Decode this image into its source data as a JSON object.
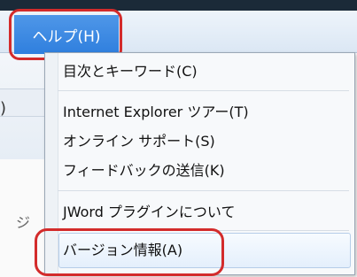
{
  "menu": {
    "header_label": "ヘルプ(H)",
    "items": [
      {
        "label": "目次とキーワード(C)"
      },
      {
        "label": "Internet Explorer ツアー(T)"
      },
      {
        "label": "オンライン サポート(S)"
      },
      {
        "label": "フィードバックの送信(K)"
      },
      {
        "label": "JWord プラグインについて"
      },
      {
        "label": "バージョン情報(A)"
      }
    ]
  },
  "background": {
    "fragment_1": ")",
    "fragment_2": "ジ"
  },
  "colors": {
    "menu_header_bg": "#3a86e3",
    "highlight_outline": "#d32b2b",
    "menu_bg": "#f7f9fb"
  }
}
